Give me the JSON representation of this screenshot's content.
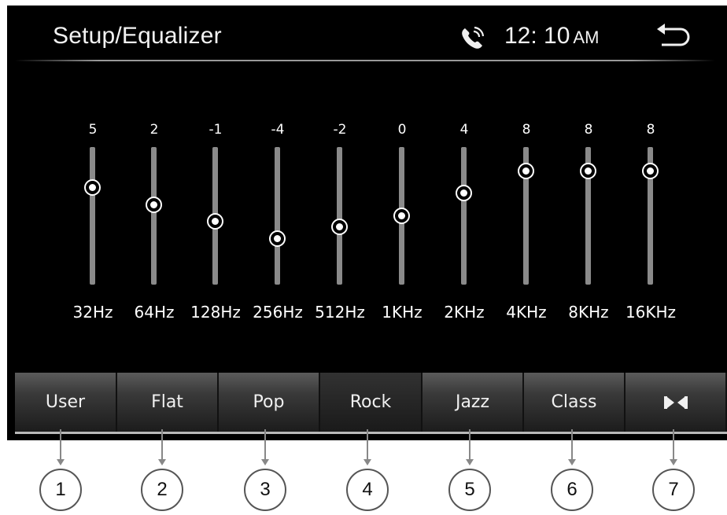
{
  "header": {
    "title": "Setup/Equalizer",
    "time": "12: 10",
    "ampm": "AM"
  },
  "icons": {
    "phone": "phone-icon",
    "back": "back-arrow-icon"
  },
  "equalizer": {
    "bands": [
      {
        "freq": "32Hz",
        "value": "5"
      },
      {
        "freq": "64Hz",
        "value": "2"
      },
      {
        "freq": "128Hz",
        "value": "-1"
      },
      {
        "freq": "256Hz",
        "value": "-4"
      },
      {
        "freq": "512Hz",
        "value": "-2"
      },
      {
        "freq": "1KHz",
        "value": "0"
      },
      {
        "freq": "2KHz",
        "value": "4"
      },
      {
        "freq": "4KHz",
        "value": "8"
      },
      {
        "freq": "8KHz",
        "value": "8"
      },
      {
        "freq": "16KHz",
        "value": "8"
      }
    ]
  },
  "presets": [
    {
      "label": "User"
    },
    {
      "label": "Flat"
    },
    {
      "label": "Pop"
    },
    {
      "label": "Rock",
      "active": true
    },
    {
      "label": "Jazz"
    },
    {
      "label": "Class"
    },
    {
      "label": "",
      "icon": "balance-fader-icon"
    }
  ],
  "callouts": [
    "1",
    "2",
    "3",
    "4",
    "5",
    "6",
    "7"
  ],
  "colors": {
    "screen_bg": "#000000",
    "text": "#ffffff",
    "track": "#8a8a8a",
    "button_top": "#5b5b5b",
    "button_bottom": "#1c1c1c"
  }
}
